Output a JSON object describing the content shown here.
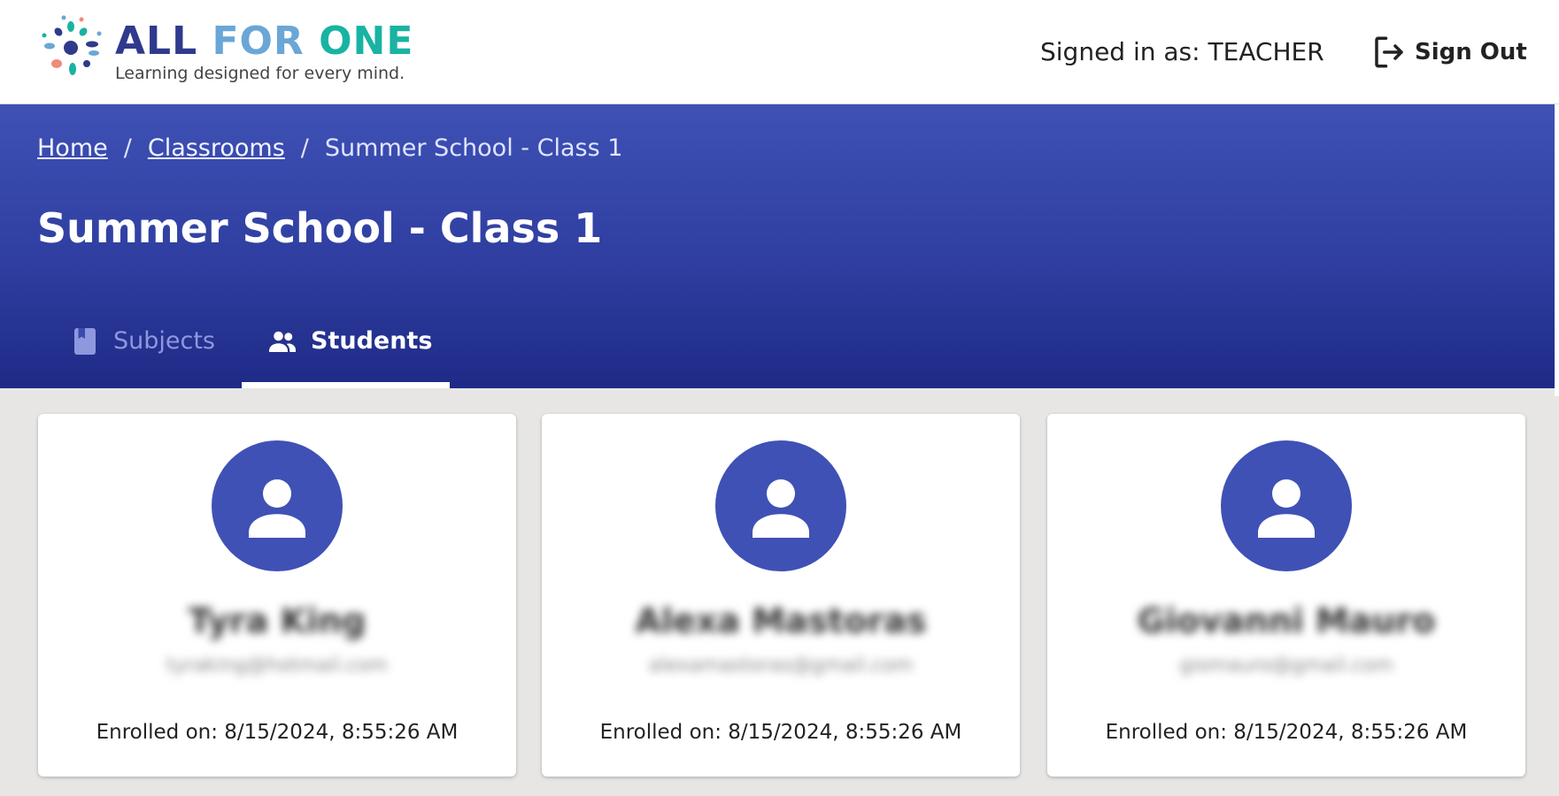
{
  "brand": {
    "title_part1": "ALL",
    "title_part2": "FOR",
    "title_part3": "ONE",
    "tagline": "Learning designed for every mind."
  },
  "header": {
    "signed_in_text": "Signed in as: TEACHER",
    "sign_out_label": "Sign Out"
  },
  "breadcrumb": {
    "home": "Home",
    "separator": "/",
    "classrooms": "Classrooms",
    "current": "Summer School - Class 1"
  },
  "page": {
    "title": "Summer School - Class 1"
  },
  "tabs": [
    {
      "label": "Subjects",
      "icon": "book-icon",
      "active": false
    },
    {
      "label": "Students",
      "icon": "group-icon",
      "active": true
    }
  ],
  "students": [
    {
      "name": "Tyra King",
      "email": "tyraking@hotmail.com",
      "enrolled": "Enrolled on: 8/15/2024, 8:55:26 AM"
    },
    {
      "name": "Alexa Mastoras",
      "email": "alexamastoras@gmail.com",
      "enrolled": "Enrolled on: 8/15/2024, 8:55:26 AM"
    },
    {
      "name": "Giovanni Mauro",
      "email": "giomauro@gmail.com",
      "enrolled": "Enrolled on: 8/15/2024, 8:55:26 AM"
    }
  ],
  "colors": {
    "primary": "#3f51b5",
    "hero_dark": "#1e2a86",
    "background": "#e7e6e5",
    "brand_navy": "#2f3a8c",
    "brand_blue": "#6aa6d6",
    "brand_teal": "#19b3a3"
  }
}
